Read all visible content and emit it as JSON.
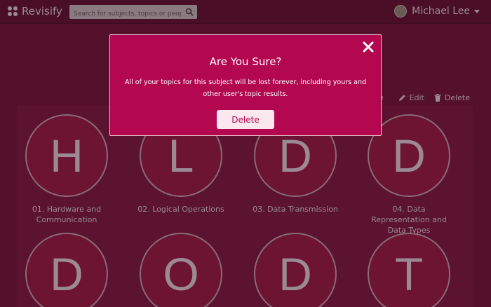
{
  "app": {
    "brand": "Revisify"
  },
  "search": {
    "placeholder": "Search for subjects, topics or people"
  },
  "user": {
    "name": "Michael Lee"
  },
  "actions": {
    "partial": "e",
    "edit": "Edit",
    "delete": "Delete"
  },
  "topics": [
    {
      "letter": "H",
      "label": "01. Hardware and Communication"
    },
    {
      "letter": "L",
      "label": "02. Logical Operations"
    },
    {
      "letter": "D",
      "label": "03. Data Transmission"
    },
    {
      "letter": "D",
      "label": "04. Data Representation and Data Types"
    },
    {
      "letter": "D",
      "label": ""
    },
    {
      "letter": "O",
      "label": ""
    },
    {
      "letter": "D",
      "label": ""
    },
    {
      "letter": "T",
      "label": ""
    }
  ],
  "modal": {
    "title": "Are You Sure?",
    "message": "All of your topics for this subject will be lost forever, including yours and other user's topic results.",
    "confirm": "Delete"
  },
  "colors": {
    "accent": "#b3084f",
    "overlay": "#55102b",
    "button": "#fbe8ef"
  }
}
